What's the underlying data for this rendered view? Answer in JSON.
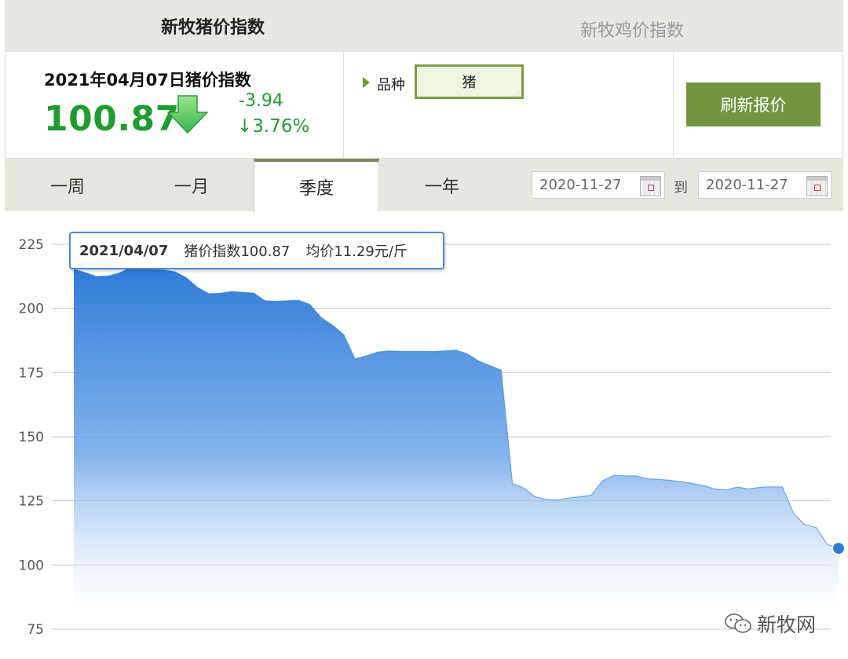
{
  "tabs": {
    "pig": "新牧猪价指数",
    "chicken": "新牧鸡价指数"
  },
  "index": {
    "date_label": "2021年04月07日猪价指数",
    "value": "100.87",
    "change": "-3.94",
    "change_pct": "↓3.76%",
    "trend_icon": "down-arrow-icon"
  },
  "variety": {
    "label": "品种",
    "selected": "猪"
  },
  "refresh_label": "刷新报价",
  "periods": [
    "一周",
    "一月",
    "季度",
    "一年"
  ],
  "active_period": "季度",
  "date_range": {
    "start": "2020-11-27",
    "to": "到",
    "end": "2020-11-27"
  },
  "tooltip": {
    "date": "2021/04/07",
    "index": "猪价指数100.87",
    "price": "均价11.29元/斤"
  },
  "watermark": "新牧网",
  "colors": {
    "accent_green": "#749540",
    "value_green": "#1f9c2f",
    "series_blue": "#2f7bd8"
  },
  "chart_data": {
    "type": "area",
    "y_ticks": [
      75,
      100,
      125,
      150,
      175,
      200,
      225
    ],
    "ylim": [
      75,
      225
    ],
    "grid": true,
    "x_labels": [],
    "series": [
      {
        "values": [
          215.2,
          214,
          212.5,
          212.6,
          213.7,
          215.9,
          215.6,
          215.1,
          215,
          214.3,
          212,
          208.2,
          205.7,
          205.9,
          206.6,
          206.3,
          206,
          203,
          202.8,
          203,
          203.2,
          201.5,
          196.4,
          193.5,
          189.8,
          180.3,
          181.5,
          183,
          183.4,
          183.3,
          183.3,
          183.3,
          183.2,
          183.5,
          183.7,
          182.3,
          179.5,
          177.7,
          176,
          131.8,
          130,
          126.6,
          125.6,
          125.4,
          126.1,
          126.6,
          127.2,
          132.8,
          134.9,
          134.8,
          134.7,
          133.6,
          133.4,
          133,
          132.5,
          131.8,
          131,
          129.6,
          129.2,
          130.4,
          129.6,
          130.3,
          130.5,
          130.4,
          120.1,
          115.7,
          114.6,
          108,
          106.5
        ]
      }
    ]
  }
}
